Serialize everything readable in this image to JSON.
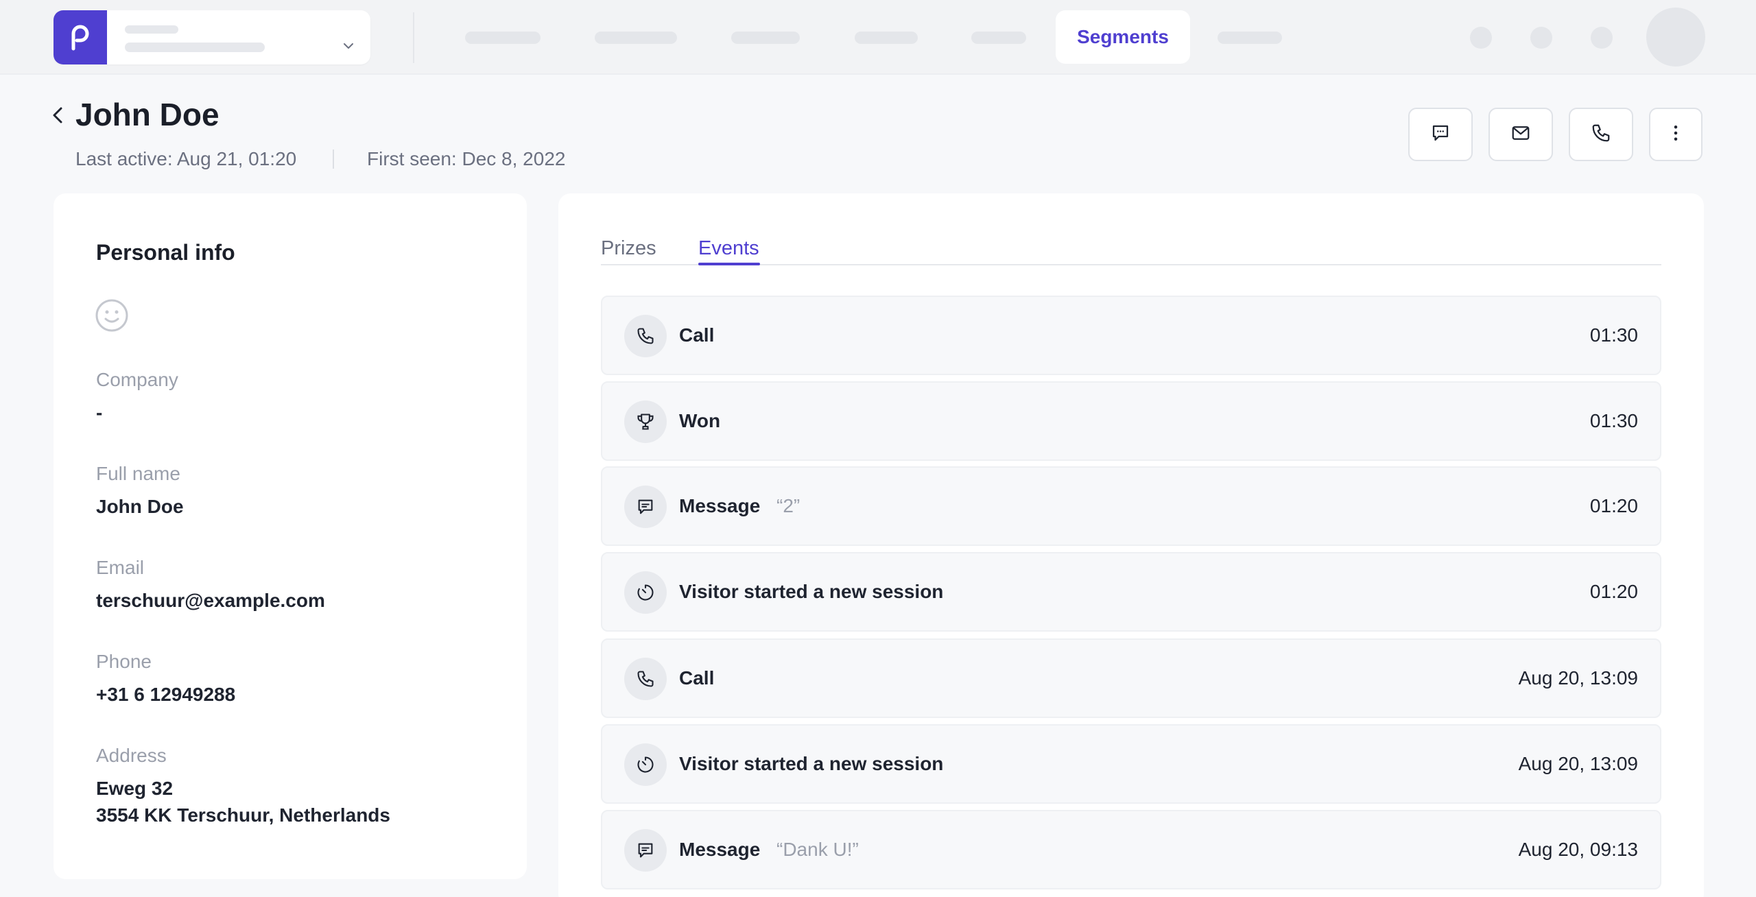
{
  "nav": {
    "active_item": "Segments",
    "brand_color": "#4f3fd0"
  },
  "header": {
    "title": "John Doe",
    "last_active": "Last active: Aug 21, 01:20",
    "first_seen": "First seen: Dec 8, 2022",
    "actions": [
      "chat-icon",
      "mail-icon",
      "phone-icon",
      "more-vertical-icon"
    ]
  },
  "personal_info": {
    "title": "Personal info",
    "company_label": "Company",
    "company_value": "-",
    "fullname_label": "Full name",
    "fullname_value": "John Doe",
    "email_label": "Email",
    "email_value": "terschuur@example.com",
    "phone_label": "Phone",
    "phone_value": "+31 6 12949288",
    "address_label": "Address",
    "address_line1": "Eweg 32",
    "address_line2": "3554 KK Terschuur, Netherlands"
  },
  "tabs": {
    "prizes": "Prizes",
    "events": "Events",
    "active": "Events"
  },
  "events": [
    {
      "icon": "phone-icon",
      "label": "Call",
      "quote": "",
      "time": "01:30"
    },
    {
      "icon": "trophy-icon",
      "label": "Won",
      "quote": "",
      "time": "01:30"
    },
    {
      "icon": "message-icon",
      "label": "Message",
      "quote": "“2”",
      "time": "01:20"
    },
    {
      "icon": "session-timer-icon",
      "label": "Visitor started a new session",
      "quote": "",
      "time": "01:20"
    },
    {
      "icon": "phone-icon",
      "label": "Call",
      "quote": "",
      "time": "Aug 20, 13:09"
    },
    {
      "icon": "session-timer-icon",
      "label": "Visitor started a new session",
      "quote": "",
      "time": "Aug 20, 13:09"
    },
    {
      "icon": "message-icon",
      "label": "Message",
      "quote": "“Dank U!”",
      "time": "Aug 20, 09:13"
    }
  ]
}
